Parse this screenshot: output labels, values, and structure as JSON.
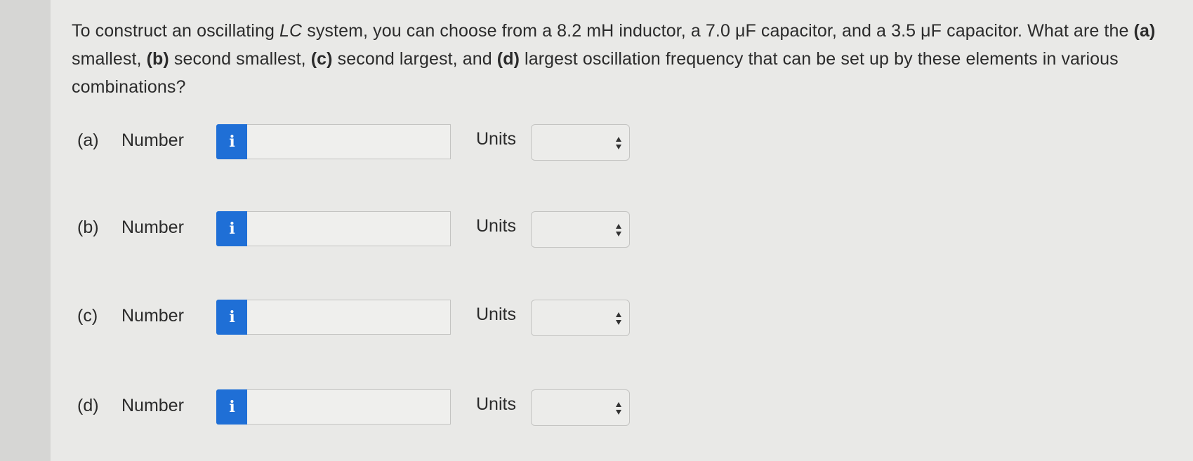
{
  "question": {
    "text_before_italic": "To construct an oscillating ",
    "italic_term": "LC",
    "text_after_italic": " system, you can choose from a 8.2 mH inductor, a 7.0 μF capacitor, and a 3.5 μF capacitor. What are the ",
    "part_a_marker": "(a)",
    "part_a_text": " smallest, ",
    "part_b_marker": "(b)",
    "part_b_text": " second smallest, ",
    "part_c_marker": "(c)",
    "part_c_text": " second largest, and ",
    "part_d_marker": "(d)",
    "part_d_text": " largest oscillation frequency that can be set up by these elements in various combinations?"
  },
  "answers": [
    {
      "part": "(a)",
      "number_label": "Number",
      "info_glyph": "i",
      "number_value": "",
      "units_label": "Units",
      "units_value": ""
    },
    {
      "part": "(b)",
      "number_label": "Number",
      "info_glyph": "i",
      "number_value": "",
      "units_label": "Units",
      "units_value": ""
    },
    {
      "part": "(c)",
      "number_label": "Number",
      "info_glyph": "i",
      "number_value": "",
      "units_label": "Units",
      "units_value": ""
    },
    {
      "part": "(d)",
      "number_label": "Number",
      "info_glyph": "i",
      "number_value": "",
      "units_label": "Units",
      "units_value": ""
    }
  ],
  "icons": {
    "info": "info-icon",
    "select": "up-down-arrows-icon"
  },
  "colors": {
    "info_button": "#1f6fd6",
    "background": "#e9e9e7"
  }
}
